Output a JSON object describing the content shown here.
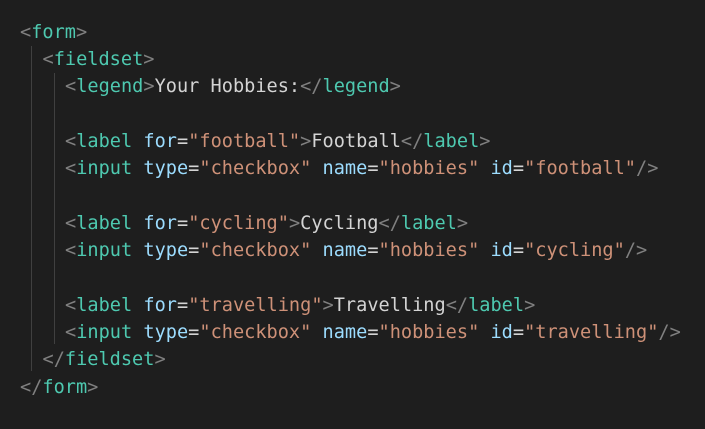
{
  "lines": [
    {
      "tokens": [
        {
          "k": "punc",
          "t": "<"
        },
        {
          "k": "tag",
          "t": "form"
        },
        {
          "k": "punc",
          "t": ">"
        }
      ]
    },
    {
      "tokens": [
        {
          "k": "punc",
          "t": "<"
        },
        {
          "k": "tag",
          "t": "fieldset"
        },
        {
          "k": "punc",
          "t": ">"
        }
      ]
    },
    {
      "tokens": [
        {
          "k": "punc",
          "t": "<"
        },
        {
          "k": "tag",
          "t": "legend"
        },
        {
          "k": "punc",
          "t": ">"
        },
        {
          "k": "txt",
          "t": "Your Hobbies:"
        },
        {
          "k": "punc",
          "t": "</"
        },
        {
          "k": "tag",
          "t": "legend"
        },
        {
          "k": "punc",
          "t": ">"
        }
      ]
    },
    {
      "tokens": []
    },
    {
      "tokens": [
        {
          "k": "punc",
          "t": "<"
        },
        {
          "k": "tag",
          "t": "label"
        },
        {
          "k": "ws",
          "t": " "
        },
        {
          "k": "attr",
          "t": "for"
        },
        {
          "k": "eq",
          "t": "="
        },
        {
          "k": "str",
          "t": "\"football\""
        },
        {
          "k": "punc",
          "t": ">"
        },
        {
          "k": "txt",
          "t": "Football"
        },
        {
          "k": "punc",
          "t": "</"
        },
        {
          "k": "tag",
          "t": "label"
        },
        {
          "k": "punc",
          "t": ">"
        }
      ]
    },
    {
      "tokens": [
        {
          "k": "punc",
          "t": "<"
        },
        {
          "k": "tag",
          "t": "input"
        },
        {
          "k": "ws",
          "t": " "
        },
        {
          "k": "attr",
          "t": "type"
        },
        {
          "k": "eq",
          "t": "="
        },
        {
          "k": "str",
          "t": "\"checkbox\""
        },
        {
          "k": "ws",
          "t": " "
        },
        {
          "k": "attr",
          "t": "name"
        },
        {
          "k": "eq",
          "t": "="
        },
        {
          "k": "str",
          "t": "\"hobbies\""
        },
        {
          "k": "ws",
          "t": " "
        },
        {
          "k": "attr",
          "t": "id"
        },
        {
          "k": "eq",
          "t": "="
        },
        {
          "k": "str",
          "t": "\"football\""
        },
        {
          "k": "punc",
          "t": "/>"
        }
      ]
    },
    {
      "tokens": []
    },
    {
      "tokens": [
        {
          "k": "punc",
          "t": "<"
        },
        {
          "k": "tag",
          "t": "label"
        },
        {
          "k": "ws",
          "t": " "
        },
        {
          "k": "attr",
          "t": "for"
        },
        {
          "k": "eq",
          "t": "="
        },
        {
          "k": "str",
          "t": "\"cycling\""
        },
        {
          "k": "punc",
          "t": ">"
        },
        {
          "k": "txt",
          "t": "Cycling"
        },
        {
          "k": "punc",
          "t": "</"
        },
        {
          "k": "tag",
          "t": "label"
        },
        {
          "k": "punc",
          "t": ">"
        }
      ]
    },
    {
      "tokens": [
        {
          "k": "punc",
          "t": "<"
        },
        {
          "k": "tag",
          "t": "input"
        },
        {
          "k": "ws",
          "t": " "
        },
        {
          "k": "attr",
          "t": "type"
        },
        {
          "k": "eq",
          "t": "="
        },
        {
          "k": "str",
          "t": "\"checkbox\""
        },
        {
          "k": "ws",
          "t": " "
        },
        {
          "k": "attr",
          "t": "name"
        },
        {
          "k": "eq",
          "t": "="
        },
        {
          "k": "str",
          "t": "\"hobbies\""
        },
        {
          "k": "ws",
          "t": " "
        },
        {
          "k": "attr",
          "t": "id"
        },
        {
          "k": "eq",
          "t": "="
        },
        {
          "k": "str",
          "t": "\"cycling\""
        },
        {
          "k": "punc",
          "t": "/>"
        }
      ]
    },
    {
      "tokens": []
    },
    {
      "tokens": [
        {
          "k": "punc",
          "t": "<"
        },
        {
          "k": "tag",
          "t": "label"
        },
        {
          "k": "ws",
          "t": " "
        },
        {
          "k": "attr",
          "t": "for"
        },
        {
          "k": "eq",
          "t": "="
        },
        {
          "k": "str",
          "t": "\"travelling\""
        },
        {
          "k": "punc",
          "t": ">"
        },
        {
          "k": "txt",
          "t": "Travelling"
        },
        {
          "k": "punc",
          "t": "</"
        },
        {
          "k": "tag",
          "t": "label"
        },
        {
          "k": "punc",
          "t": ">"
        }
      ]
    },
    {
      "tokens": [
        {
          "k": "punc",
          "t": "<"
        },
        {
          "k": "tag",
          "t": "input"
        },
        {
          "k": "ws",
          "t": " "
        },
        {
          "k": "attr",
          "t": "type"
        },
        {
          "k": "eq",
          "t": "="
        },
        {
          "k": "str",
          "t": "\"checkbox\""
        },
        {
          "k": "ws",
          "t": " "
        },
        {
          "k": "attr",
          "t": "name"
        },
        {
          "k": "eq",
          "t": "="
        },
        {
          "k": "str",
          "t": "\"hobbies\""
        },
        {
          "k": "ws",
          "t": " "
        },
        {
          "k": "attr",
          "t": "id"
        },
        {
          "k": "eq",
          "t": "="
        },
        {
          "k": "str",
          "t": "\"travelling\""
        },
        {
          "k": "punc",
          "t": "/>"
        }
      ]
    },
    {
      "tokens": [
        {
          "k": "punc",
          "t": "</"
        },
        {
          "k": "tag",
          "t": "fieldset"
        },
        {
          "k": "punc",
          "t": ">"
        }
      ]
    },
    {
      "tokens": [
        {
          "k": "punc",
          "t": "</"
        },
        {
          "k": "tag",
          "t": "form"
        },
        {
          "k": "punc",
          "t": ">"
        }
      ]
    }
  ],
  "colors": {
    "background": "#1e1e1e",
    "punctuation": "#808080",
    "tag": "#4ec9b0",
    "attribute": "#9cdcfe",
    "string": "#ce9178",
    "text": "#d4d4d4"
  }
}
